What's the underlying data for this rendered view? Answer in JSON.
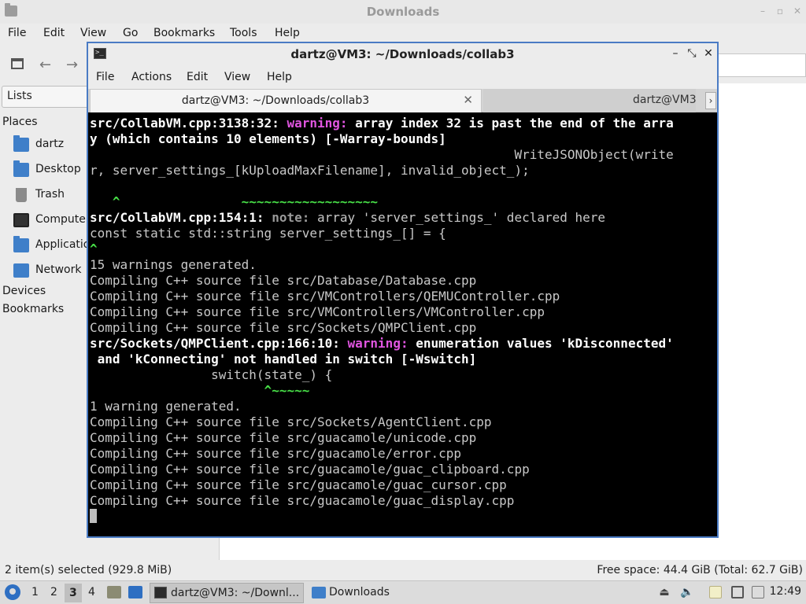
{
  "file_manager": {
    "title": "Downloads",
    "window_buttons": [
      "–",
      "▫",
      "✕"
    ],
    "menu": [
      "File",
      "Edit",
      "View",
      "Go",
      "Bookmarks",
      "Tools",
      "Help"
    ],
    "sidebar": {
      "mode": "Lists",
      "places_heading": "Places",
      "places": [
        {
          "label": "dartz",
          "icon": "home-folder-icon"
        },
        {
          "label": "Desktop",
          "icon": "desktop-folder-icon"
        },
        {
          "label": "Trash",
          "icon": "trash-icon"
        },
        {
          "label": "Computer",
          "icon": "computer-icon"
        },
        {
          "label": "Applications",
          "icon": "applications-icon"
        },
        {
          "label": "Network",
          "icon": "network-icon"
        }
      ],
      "devices_heading": "Devices",
      "bookmarks_heading": "Bookmarks"
    },
    "status_left": "2 item(s) selected (929.8 MiB)",
    "status_right": "Free space: 44.4 GiB (Total: 62.7 GiB)"
  },
  "terminal": {
    "title": "dartz@VM3: ~/Downloads/collab3",
    "menu": [
      "File",
      "Actions",
      "Edit",
      "View",
      "Help"
    ],
    "tabs": [
      {
        "label": "dartz@VM3: ~/Downloads/collab3",
        "active": true
      },
      {
        "label": "dartz@VM3",
        "active": false
      }
    ],
    "lines": [
      [
        {
          "t": "src/CollabVM.cpp:3138:32: ",
          "c": "b"
        },
        {
          "t": "warning: ",
          "c": "warn"
        },
        {
          "t": "array index 32 is past the end of the arra",
          "c": "b"
        }
      ],
      [
        {
          "t": "y (which contains 10 elements) [-Warray-bounds]",
          "c": "b"
        }
      ],
      [
        {
          "t": "                                                        WriteJSONObject(write",
          "c": ""
        }
      ],
      [
        {
          "t": "r, server_settings_[kUploadMaxFilename], invalid_object_);",
          "c": ""
        }
      ],
      [
        {
          "t": "",
          "c": ""
        }
      ],
      [
        {
          "t": "   ^",
          "c": "grn"
        },
        {
          "t": "                ~~~~~~~~~~~~~~~~~~",
          "c": "grn"
        }
      ],
      [
        {
          "t": "src/CollabVM.cpp:154:1: ",
          "c": "b"
        },
        {
          "t": "note: ",
          "c": "note"
        },
        {
          "t": "array 'server_settings_' declared here",
          "c": ""
        }
      ],
      [
        {
          "t": "const static std::string server_settings_[] = {",
          "c": ""
        }
      ],
      [
        {
          "t": "^",
          "c": "grn"
        }
      ],
      [
        {
          "t": "15 warnings generated.",
          "c": ""
        }
      ],
      [
        {
          "t": "Compiling C++ source file src/Database/Database.cpp",
          "c": ""
        }
      ],
      [
        {
          "t": "Compiling C++ source file src/VMControllers/QEMUController.cpp",
          "c": ""
        }
      ],
      [
        {
          "t": "Compiling C++ source file src/VMControllers/VMController.cpp",
          "c": ""
        }
      ],
      [
        {
          "t": "Compiling C++ source file src/Sockets/QMPClient.cpp",
          "c": ""
        }
      ],
      [
        {
          "t": "src/Sockets/QMPClient.cpp:166:10: ",
          "c": "b"
        },
        {
          "t": "warning: ",
          "c": "warn"
        },
        {
          "t": "enumeration values 'kDisconnected'",
          "c": "b"
        }
      ],
      [
        {
          "t": " and 'kConnecting' not handled in switch [-Wswitch]",
          "c": "b"
        }
      ],
      [
        {
          "t": "                switch(state_) {",
          "c": ""
        }
      ],
      [
        {
          "t": "                       ^~~~~~",
          "c": "grn"
        }
      ],
      [
        {
          "t": "1 warning generated.",
          "c": ""
        }
      ],
      [
        {
          "t": "Compiling C++ source file src/Sockets/AgentClient.cpp",
          "c": ""
        }
      ],
      [
        {
          "t": "Compiling C++ source file src/guacamole/unicode.cpp",
          "c": ""
        }
      ],
      [
        {
          "t": "Compiling C++ source file src/guacamole/error.cpp",
          "c": ""
        }
      ],
      [
        {
          "t": "Compiling C++ source file src/guacamole/guac_clipboard.cpp",
          "c": ""
        }
      ],
      [
        {
          "t": "Compiling C++ source file src/guacamole/guac_cursor.cpp",
          "c": ""
        }
      ],
      [
        {
          "t": "Compiling C++ source file src/guacamole/guac_display.cpp",
          "c": ""
        }
      ]
    ]
  },
  "taskbar": {
    "workspaces": [
      "1",
      "2",
      "3",
      "4"
    ],
    "active_workspace": "3",
    "tasks": [
      {
        "label": "dartz@VM3: ~/Downl...",
        "icon": "terminal-icon"
      },
      {
        "label": "Downloads",
        "icon": "folder-icon"
      }
    ],
    "clock": "12:49"
  },
  "colors": {
    "accent": "#4a7bc4",
    "terminal_bg": "#000000",
    "warning": "#e055e0",
    "caret": "#48e048"
  }
}
